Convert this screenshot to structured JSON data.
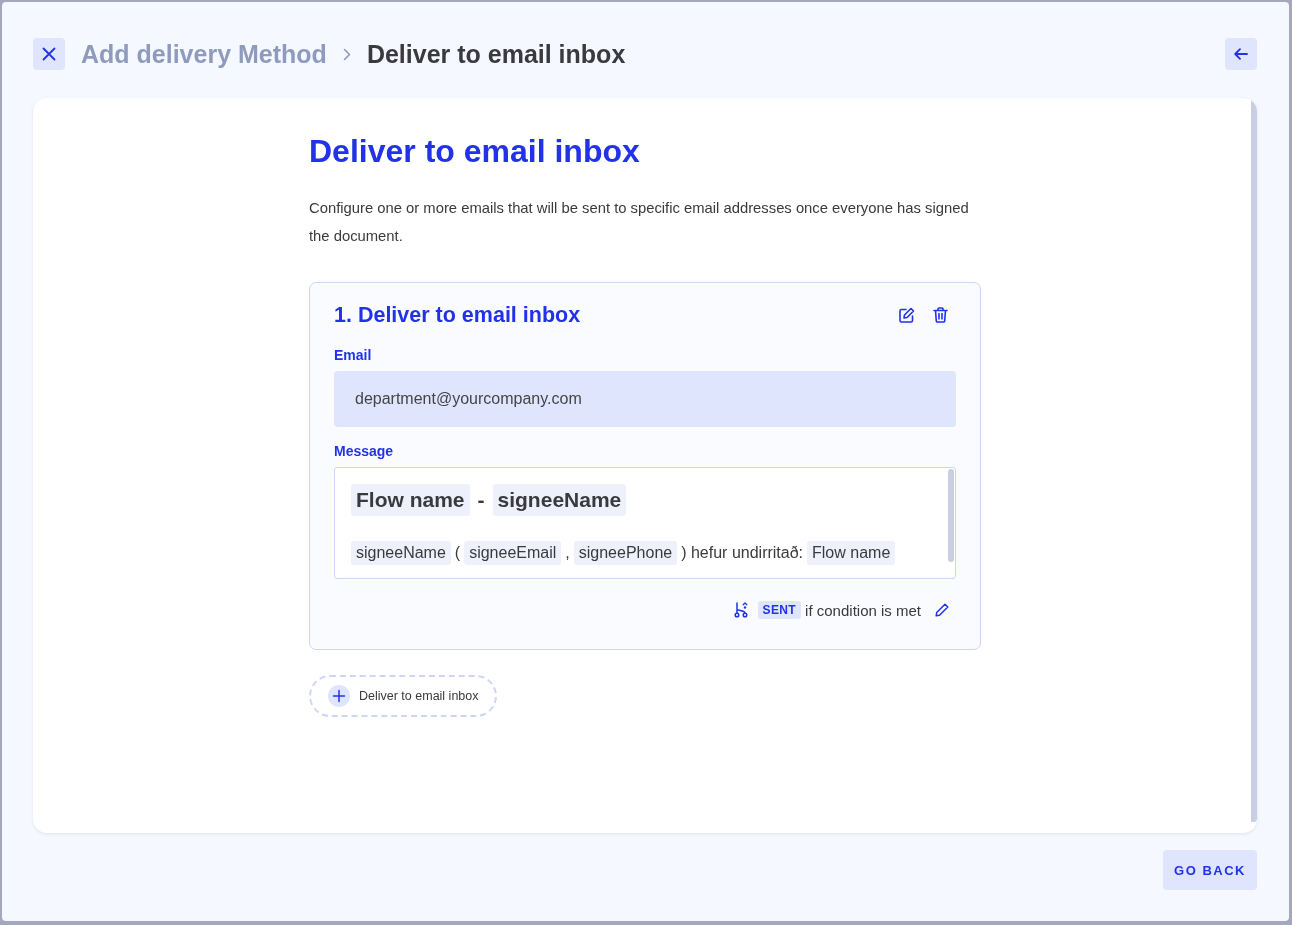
{
  "header": {
    "breadcrumb": [
      {
        "label": "Add delivery Method",
        "current": false
      },
      {
        "label": "Deliver to email inbox",
        "current": true
      }
    ]
  },
  "content": {
    "title": "Deliver to email inbox",
    "description": "Configure one or more emails that will be sent to specific email addresses once everyone has signed the document."
  },
  "deliveries": [
    {
      "title": "1. Deliver to email inbox",
      "email": {
        "label": "Email",
        "value": "department@yourcompany.com"
      },
      "message": {
        "label": "Message",
        "subject": [
          {
            "kind": "variable",
            "text": "Flow name"
          },
          {
            "kind": "text",
            "text": "-"
          },
          {
            "kind": "variable",
            "text": "signeeName"
          }
        ],
        "body": [
          {
            "kind": "variable",
            "text": "signeeName"
          },
          {
            "kind": "text",
            "text": "("
          },
          {
            "kind": "variable",
            "text": "signeeEmail"
          },
          {
            "kind": "text",
            "text": ","
          },
          {
            "kind": "variable",
            "text": "signeePhone"
          },
          {
            "kind": "text",
            "text": ") hefur undirritað:"
          },
          {
            "kind": "variable",
            "text": "Flow name"
          }
        ]
      },
      "condition": {
        "badge": "SENT",
        "text": "if condition is met"
      }
    }
  ],
  "add_delivery": {
    "label": "Deliver to email inbox"
  },
  "footer": {
    "button": "GO BACK"
  }
}
